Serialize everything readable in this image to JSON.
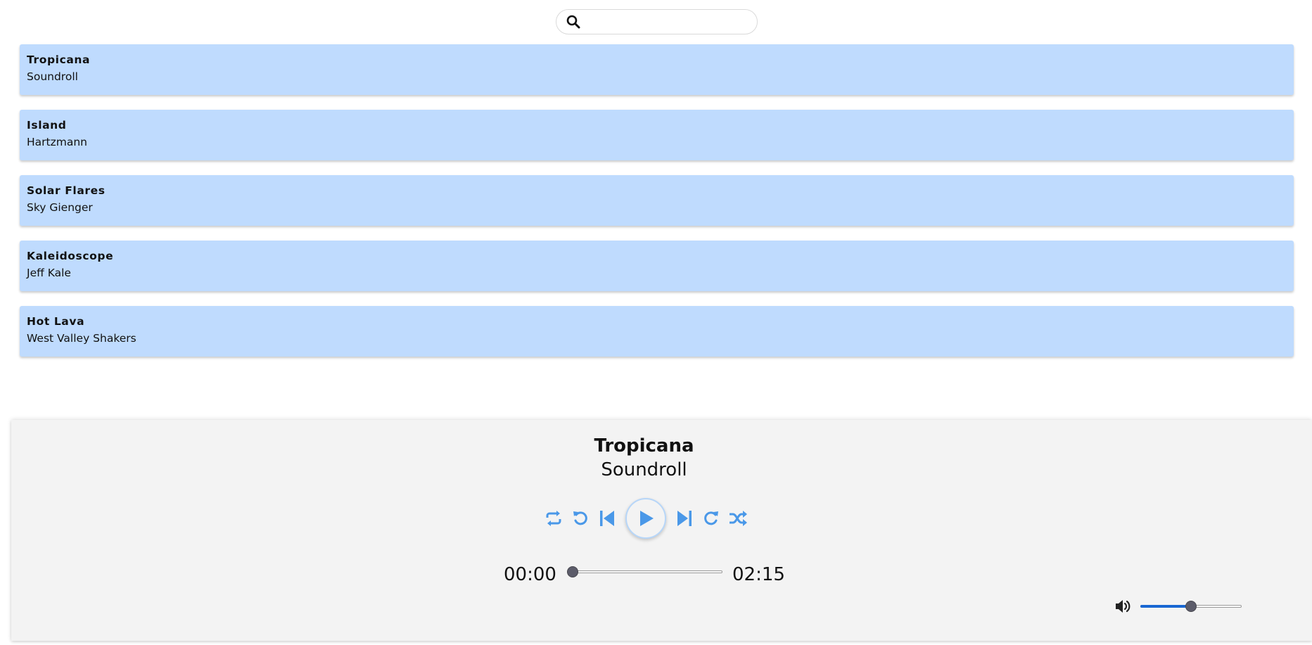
{
  "search": {
    "placeholder": "",
    "value": "",
    "icon": "search-icon"
  },
  "playlist": [
    {
      "title": "Tropicana",
      "artist": "Soundroll"
    },
    {
      "title": "Island",
      "artist": "Hartzmann"
    },
    {
      "title": "Solar Flares",
      "artist": "Sky Gienger"
    },
    {
      "title": "Kaleidoscope",
      "artist": "Jeff Kale"
    },
    {
      "title": "Hot Lava",
      "artist": "West Valley Shakers"
    }
  ],
  "player": {
    "now_playing_title": "Tropicana",
    "now_playing_artist": "Soundroll",
    "current_time": "00:00",
    "duration": "02:15",
    "progress": 0,
    "volume": 0.5,
    "controls": [
      "repeat-icon",
      "rewind-icon",
      "previous-icon",
      "play-icon",
      "next-icon",
      "forward-icon",
      "shuffle-icon"
    ],
    "volume_icon": "volume-icon"
  },
  "colors": {
    "track_bg": "#bfdbfe",
    "accent": "#4a98e8",
    "volume_fill": "#1867d2",
    "player_bg": "#f3f3f3"
  }
}
